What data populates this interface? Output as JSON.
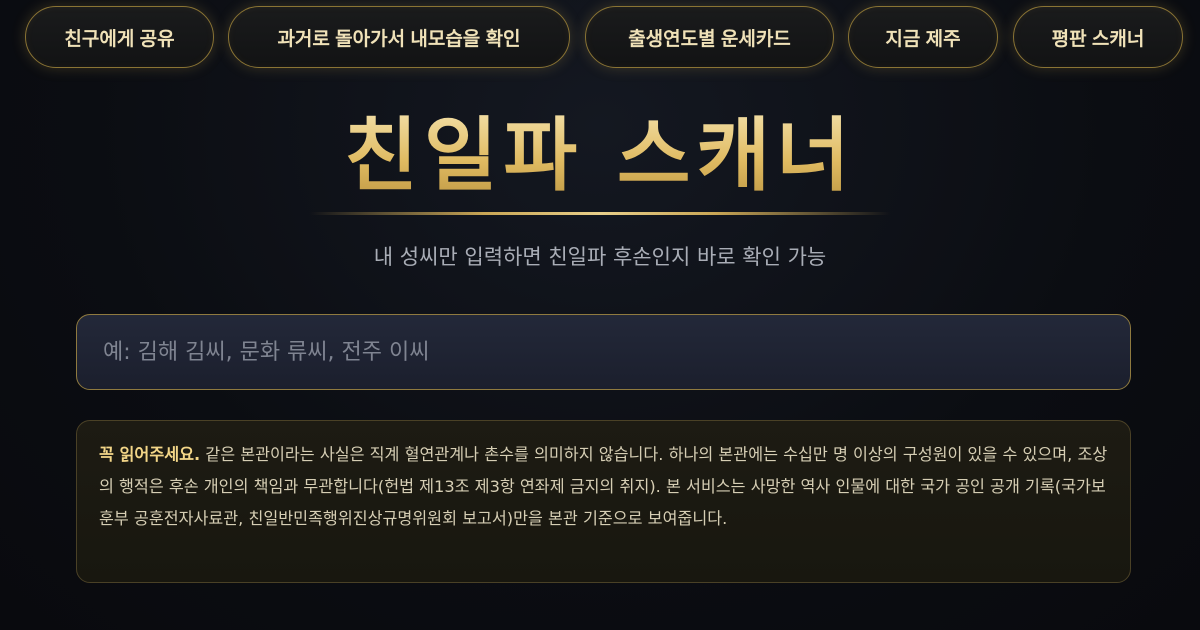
{
  "nav": {
    "items": [
      {
        "label": "친구에게 공유"
      },
      {
        "label": "과거로 돌아가서 내모습을 확인"
      },
      {
        "label": "출생연도별 운세카드"
      },
      {
        "label": "지금 제주"
      },
      {
        "label": "평판 스캐너"
      }
    ]
  },
  "hero": {
    "title": "친일파 스캐너",
    "subtitle": "내 성씨만 입력하면 친일파 후손인지 바로 확인 가능"
  },
  "search": {
    "placeholder": "예: 김해 김씨, 문화 류씨, 전주 이씨",
    "value": ""
  },
  "notice": {
    "strong": "꼭 읽어주세요.",
    "body": "같은 본관이라는 사실은 직계 혈연관계나 촌수를 의미하지 않습니다. 하나의 본관에는 수십만 명 이상의 구성원이 있을 수 있으며, 조상의 행적은 후손 개인의 책임과 무관합니다(헌법 제13조 제3항 연좌제 금지의 취지). 본 서비스는 사망한 역사 인물에 대한 국가 공인 공개 기록(국가보훈부 공훈전자사료관, 친일반민족행위진상규명위원회 보고서)만을 본관 기준으로 보여줍니다."
  },
  "colors": {
    "accent": "#e0bb62",
    "background": "#0b0d12",
    "border_gold": "#8a7434"
  }
}
